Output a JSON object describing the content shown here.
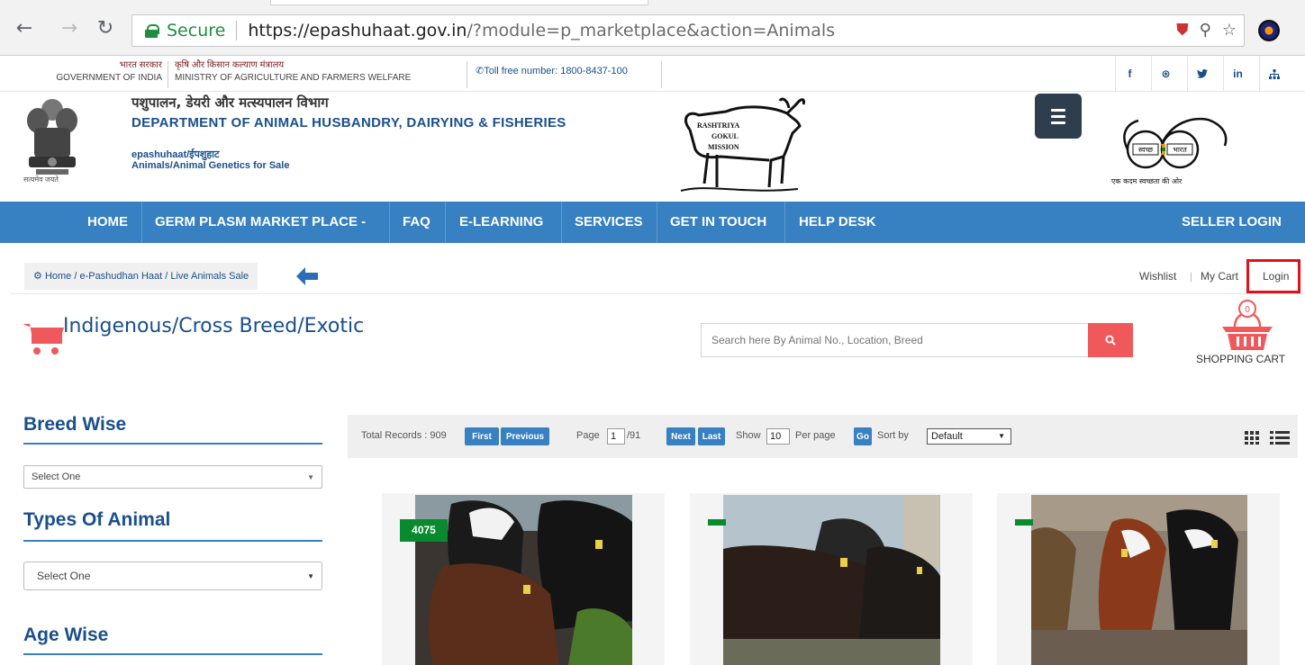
{
  "browser": {
    "secure_label": "Secure",
    "url_host": "https://epashuhaat.gov.in",
    "url_path": "/?module=p_marketplace&action=Animals"
  },
  "gov_strip": {
    "gov_hi": "भारत सरकार",
    "gov_en": "GOVERNMENT OF INDIA",
    "ministry_hi": "कृषि और किसान कल्याण मंत्रालय",
    "ministry_en": "MINISTRY OF AGRICULTURE AND FARMERS WELFARE",
    "tollfree": "Toll free number: 1800-8437-100",
    "social": [
      {
        "icon": "facebook-icon",
        "glyph": "f"
      },
      {
        "icon": "dribbble-icon",
        "glyph": "⊛"
      },
      {
        "icon": "twitter-icon",
        "glyph": "🐦"
      },
      {
        "icon": "linkedin-icon",
        "glyph": "in"
      },
      {
        "icon": "sitemap-icon",
        "glyph": "⊞"
      }
    ]
  },
  "header": {
    "emblem_caption": "सत्यमेव जयते",
    "dept_hi": "पशुपालन, डेयरी और मत्स्यपालन विभाग",
    "dept_en": "DEPARTMENT OF ANIMAL HUSBANDRY, DAIRYING & FISHERIES",
    "site_name": "epashuhaat/ईपशुहाट",
    "site_tagline": "Animals/Animal Genetics for Sale",
    "rgm_logo_lines": [
      "RASHTRIYA",
      "GOKUL",
      "MISSION"
    ],
    "swachh_left": "स्वच्छ",
    "swachh_right": "भारत",
    "swachh_caption": "एक कदम स्वच्छता की ओर"
  },
  "nav": {
    "items": [
      "HOME",
      "GERM PLASM MARKET PLACE -",
      "FAQ",
      "E-LEARNING",
      "SERVICES",
      "GET IN TOUCH",
      "HELP DESK"
    ],
    "seller_login": "SELLER LOGIN"
  },
  "breadcrumb": {
    "text": "Home / e-Pashudhan Haat / Live Animals Sale"
  },
  "toplinks": {
    "wishlist": "Wishlist",
    "mycart": "My Cart",
    "login": "Login"
  },
  "page": {
    "title": "Indigenous/Cross Breed/Exotic",
    "search_placeholder": "Search here By Animal No., Location, Breed",
    "cart_count": "0",
    "cart_label": "SHOPPING CART"
  },
  "sidebar": {
    "breed_heading": "Breed Wise",
    "breed_select": "Select One",
    "types_heading": "Types Of Animal",
    "types_select": "Select One",
    "age_heading": "Age Wise"
  },
  "toolbar": {
    "total_records": "Total Records : 909",
    "first": "First",
    "previous": "Previous",
    "page_label": "Page",
    "page_value": "1",
    "page_total": "/91",
    "next": "Next",
    "last": "Last",
    "show_label": "Show",
    "show_value": "10",
    "per_page": "Per page",
    "go": "Go",
    "sort_label": "Sort by",
    "sort_value": "Default"
  },
  "products": [
    {
      "tag": "4075"
    },
    {
      "tag": ""
    },
    {
      "tag": ""
    }
  ],
  "colors": {
    "nav_blue": "#3780c1",
    "heading_blue": "#1a4f8a",
    "search_red": "#f0595c",
    "tag_green": "#0a8a2f",
    "login_highlight": "#e0111b"
  }
}
